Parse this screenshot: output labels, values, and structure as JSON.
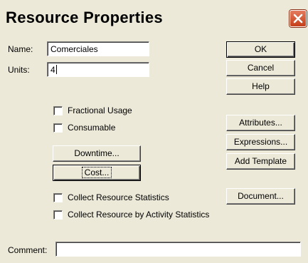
{
  "dialog": {
    "title": "Resource Properties"
  },
  "fields": {
    "name_label": "Name:",
    "name_value": "Comerciales",
    "units_label": "Units:",
    "units_value": "4",
    "comment_label": "Comment:",
    "comment_value": ""
  },
  "checkboxes": {
    "fractional_usage": {
      "label": "Fractional Usage",
      "checked": false
    },
    "consumable": {
      "label": "Consumable",
      "checked": false
    },
    "collect_resource_statistics": {
      "label": "Collect Resource Statistics",
      "checked": false
    },
    "collect_by_activity": {
      "label": "Collect Resource by Activity Statistics",
      "checked": false
    }
  },
  "buttons": {
    "ok": "OK",
    "cancel": "Cancel",
    "help": "Help",
    "attributes": "Attributes...",
    "expressions": "Expressions...",
    "add_template": "Add Template",
    "document": "Document...",
    "downtime": "Downtime...",
    "cost": "Cost..."
  },
  "icons": {
    "close": "close-icon"
  },
  "colors": {
    "dialog_bg": "#ece9d8",
    "close_button": "#c4401a"
  }
}
